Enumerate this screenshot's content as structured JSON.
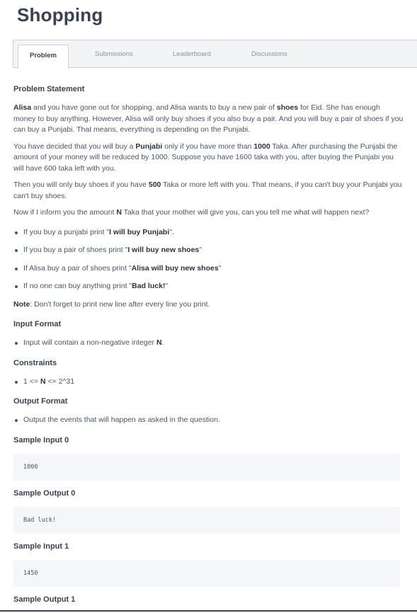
{
  "page_title": "Shopping",
  "tabs": [
    {
      "label": "Problem",
      "active": true
    },
    {
      "label": "Submissions",
      "active": false
    },
    {
      "label": "Leaderboard",
      "active": false
    },
    {
      "label": "Discussions",
      "active": false
    }
  ],
  "problem": {
    "heading": "Problem Statement",
    "p1": {
      "alisa": "Alisa",
      "t1": " and you have gone out for shopping, and Alisa wants to buy a new pair of ",
      "shoes": "shoes",
      "t2": " for Eid. She has enough money to buy anything. However, Alisa will only buy shoes if you also buy a pair. And you will buy a pair of shoes if you can buy a Punjabi. That means, everything is depending on the Punjabi."
    },
    "p2": {
      "t1": "You have decided that you will buy a ",
      "punjabi": "Punjabi",
      "t2": " only if you have more than ",
      "n1000": "1000",
      "t3": " Taka. After purchasing the Punjabi the amount of your money will be reduced by 1000. Suppose you have 1600 taka with you, after buying the Punjabi you will have 600 taka left with you."
    },
    "p3": {
      "t1": "Then you will only buy shoes if you have ",
      "n500": "500",
      "t2": " Taka or more left with you. That means, if you can't buy your Punjabi you can't buy shoes."
    },
    "p4": {
      "t1": "Now if I inform you the amount ",
      "n": "N",
      "t2": " Taka that your mother will give you, can you tell me what will happen next?"
    },
    "bullets": [
      {
        "pre": "If you buy a punjabi print \"",
        "bold": "I will buy Punjabi",
        "post": "\"."
      },
      {
        "pre": "If you buy a pair of shoes print \"",
        "bold": "I will buy new shoes",
        "post": "\""
      },
      {
        "pre": "If Alisa buy a pair of shoes print \"",
        "bold": "Alisa will buy new shoes",
        "post": "\""
      },
      {
        "pre": "If no one can buy anything print \"",
        "bold": "Bad luck!",
        "post": "\""
      }
    ],
    "note": {
      "label": "Note",
      "text": ": Don't forget to print new line after every line you print."
    }
  },
  "input_format": {
    "heading": "Input Format",
    "pre": "Input will contain a non-negative integer ",
    "bold": "N",
    "post": "."
  },
  "constraints": {
    "heading": "Constraints",
    "pre": "1 <= ",
    "bold": "N",
    "post": " <= 2^31"
  },
  "output_format": {
    "heading": "Output Format",
    "text": "Output the events that will happen as asked in the question."
  },
  "samples": [
    {
      "heading": "Sample Input 0",
      "value": "1000"
    },
    {
      "heading": "Sample Output 0",
      "value": "Bad luck!"
    },
    {
      "heading": "Sample Input 1",
      "value": "1450"
    },
    {
      "heading": "Sample Output 1",
      "value": ""
    }
  ]
}
